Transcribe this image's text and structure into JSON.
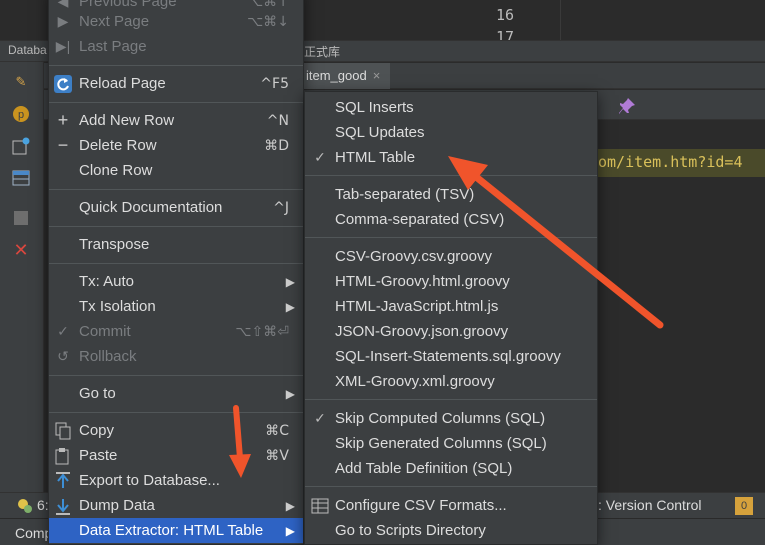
{
  "background": {
    "line_numbers": [
      "16",
      "17"
    ],
    "tool_window_tab": "Databa",
    "tool_window_tab_right": "正式库",
    "file_tab": "item_good",
    "file_tab_close": "×",
    "url_snippet": "om/item.htm?id=4",
    "status_bar": {
      "left_number": "6:",
      "left_label": "Comp",
      "version_control": ": Version Control",
      "right_number": "0"
    }
  },
  "context_menu": {
    "items": [
      {
        "label": "Previous Page",
        "shortcut": "⌥⌘↑",
        "state": "disabled"
      },
      {
        "label": "Next Page",
        "shortcut": "⌥⌘↓",
        "state": "disabled"
      },
      {
        "label": "Last Page",
        "shortcut": "",
        "state": "disabled"
      },
      {
        "label": "Reload Page",
        "shortcut": "^F5",
        "state": "normal"
      },
      {
        "label": "Add New Row",
        "shortcut": "^N",
        "state": "normal"
      },
      {
        "label": "Delete Row",
        "shortcut": "⌘D",
        "state": "normal"
      },
      {
        "label": "Clone Row",
        "shortcut": "",
        "state": "normal"
      },
      {
        "label": "Quick Documentation",
        "shortcut": "^J",
        "state": "normal"
      },
      {
        "label": "Transpose",
        "shortcut": "",
        "state": "normal"
      },
      {
        "label": "Tx: Auto",
        "shortcut": "",
        "state": "submenu"
      },
      {
        "label": "Tx Isolation",
        "shortcut": "",
        "state": "submenu"
      },
      {
        "label": "Commit",
        "shortcut": "⌥⇧⌘⏎",
        "state": "disabled"
      },
      {
        "label": "Rollback",
        "shortcut": "",
        "state": "disabled"
      },
      {
        "label": "Go to",
        "shortcut": "",
        "state": "submenu"
      },
      {
        "label": "Copy",
        "shortcut": "⌘C",
        "state": "normal"
      },
      {
        "label": "Paste",
        "shortcut": "⌘V",
        "state": "normal"
      },
      {
        "label": "Export to Database...",
        "shortcut": "",
        "state": "normal"
      },
      {
        "label": "Dump Data",
        "shortcut": "",
        "state": "submenu"
      },
      {
        "label": "Data Extractor: HTML Table",
        "shortcut": "",
        "state": "selected"
      }
    ],
    "submenu_arrow": "▶"
  },
  "submenu": {
    "check_mark": "✓",
    "items": [
      {
        "label": "SQL Inserts",
        "checked": false
      },
      {
        "label": "SQL Updates",
        "checked": false
      },
      {
        "label": "HTML Table",
        "checked": true
      },
      {
        "label": "Tab-separated (TSV)",
        "checked": false
      },
      {
        "label": "Comma-separated (CSV)",
        "checked": false
      },
      {
        "label": "CSV-Groovy.csv.groovy",
        "checked": false
      },
      {
        "label": "HTML-Groovy.html.groovy",
        "checked": false
      },
      {
        "label": "HTML-JavaScript.html.js",
        "checked": false
      },
      {
        "label": "JSON-Groovy.json.groovy",
        "checked": false
      },
      {
        "label": "SQL-Insert-Statements.sql.groovy",
        "checked": false
      },
      {
        "label": "XML-Groovy.xml.groovy",
        "checked": false
      },
      {
        "label": "Skip Computed Columns (SQL)",
        "checked": true
      },
      {
        "label": "Skip Generated Columns (SQL)",
        "checked": false
      },
      {
        "label": "Add Table Definition (SQL)",
        "checked": false
      },
      {
        "label": "Configure CSV Formats...",
        "checked": false
      },
      {
        "label": "Go to Scripts Directory",
        "checked": false
      }
    ]
  },
  "colors": {
    "selection": "#2e63c4",
    "annotation_arrow": "#f0542b",
    "menu_bg": "#3c3f41"
  }
}
